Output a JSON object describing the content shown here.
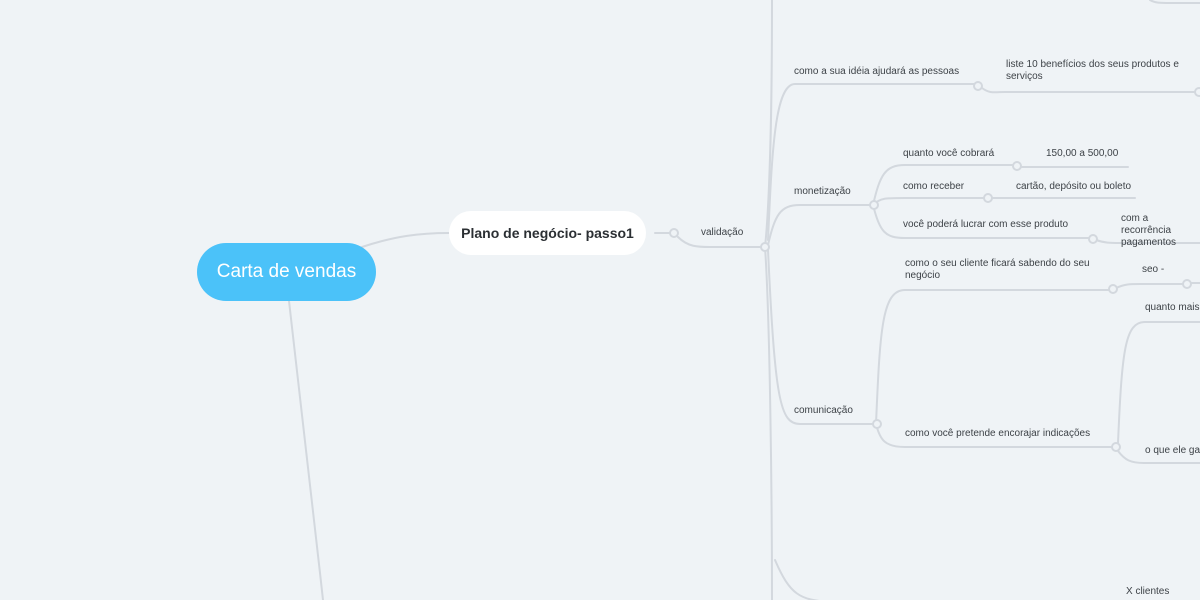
{
  "root": {
    "label": "Carta de vendas"
  },
  "main_topic": {
    "label": "Plano de negócio- passo1"
  },
  "validacao": {
    "label": "validação"
  },
  "ideia": {
    "label": "como a sua idéia ajudará as pessoas",
    "beneficios": "liste 10 benefícios dos seus produtos e serviços"
  },
  "monetizacao": {
    "label": "monetização",
    "cobrara": "quanto você cobrará",
    "cobrara_valor": "150,00 a 500,00",
    "receber": "como receber",
    "receber_valor": "cartão, depósito ou boleto",
    "lucrar": "você poderá lucrar com esse produto",
    "lucrar_valor": "com a recorrência pagamentos"
  },
  "comunicacao": {
    "label": "comunicação",
    "sabendo": "como o seu cliente ficará sabendo do seu negócio",
    "seo": "seo -",
    "indicacoes": "como você pretende encorajar indicações",
    "quanto_mais": "quanto mais",
    "o_que_ele": "o que ele gan"
  },
  "bottom": {
    "x_clientes": "X clientes"
  },
  "colors": {
    "background": "#eff3f6",
    "root": "#4bc2f9",
    "connector": "#d3d8de",
    "text": "#3d4247"
  }
}
